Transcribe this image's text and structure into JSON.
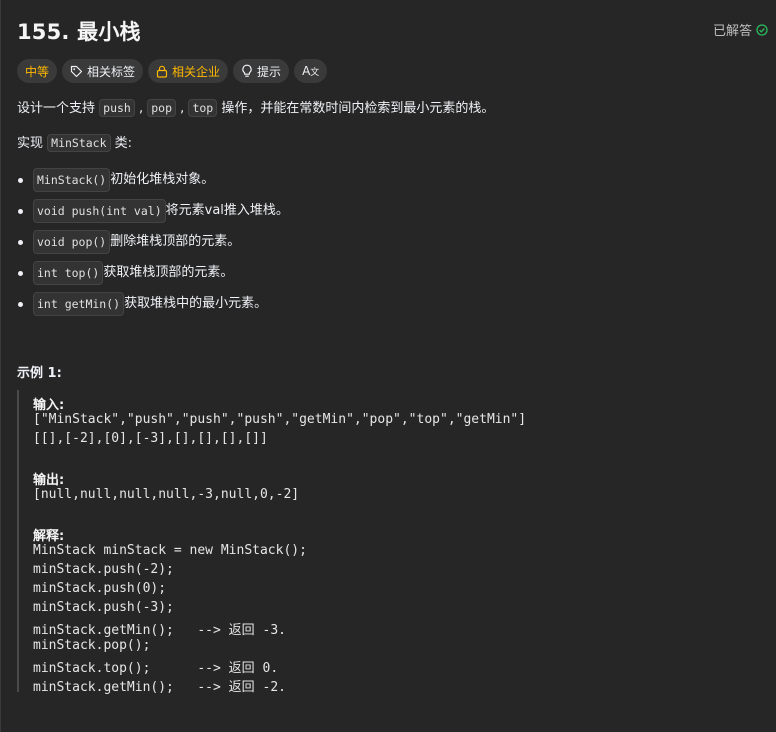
{
  "header": {
    "title": "155. 最小栈",
    "solved": "已解答"
  },
  "tags": {
    "difficulty": "中等",
    "related_tags": "相关标签",
    "related_companies": "相关企业",
    "hint": "提示",
    "translate": "A"
  },
  "description": {
    "intro_prefix": "设计一个支持 ",
    "intro_code1": "push",
    "intro_sep1": " , ",
    "intro_code2": "pop",
    "intro_sep2": " , ",
    "intro_code3": "top",
    "intro_suffix": " 操作，并能在常数时间内检索到最小元素的栈。",
    "impl_prefix": "实现 ",
    "impl_code": "MinStack",
    "impl_suffix": " 类:",
    "methods": [
      {
        "code": "MinStack()",
        "text": " 初始化堆栈对象。"
      },
      {
        "code": "void push(int val)",
        "text": " 将元素val推入堆栈。"
      },
      {
        "code": "void pop()",
        "text": " 删除堆栈顶部的元素。"
      },
      {
        "code": "int top()",
        "text": " 获取堆栈顶部的元素。"
      },
      {
        "code": "int getMin()",
        "text": " 获取堆栈中的最小元素。"
      }
    ]
  },
  "example": {
    "title": "示例 1:",
    "input_label": "输入:",
    "input_line1": "[\"MinStack\",\"push\",\"push\",\"push\",\"getMin\",\"pop\",\"top\",\"getMin\"]",
    "input_line2": "[[],[-2],[0],[-3],[],[],[],[]]",
    "output_label": "输出:",
    "output_line": "[null,null,null,null,-3,null,0,-2]",
    "explain_label": "解释:",
    "explain_lines": [
      "MinStack minStack = new MinStack();",
      "minStack.push(-2);",
      "minStack.push(0);",
      "minStack.push(-3);",
      "minStack.getMin();   --> 返回 -3.",
      "minStack.pop();",
      "minStack.top();      --> 返回 0.",
      "minStack.getMin();   --> 返回 -2."
    ]
  },
  "colors": {
    "background": "#262626",
    "difficulty": "#ffb800",
    "solved_check": "#2cbb5d"
  }
}
